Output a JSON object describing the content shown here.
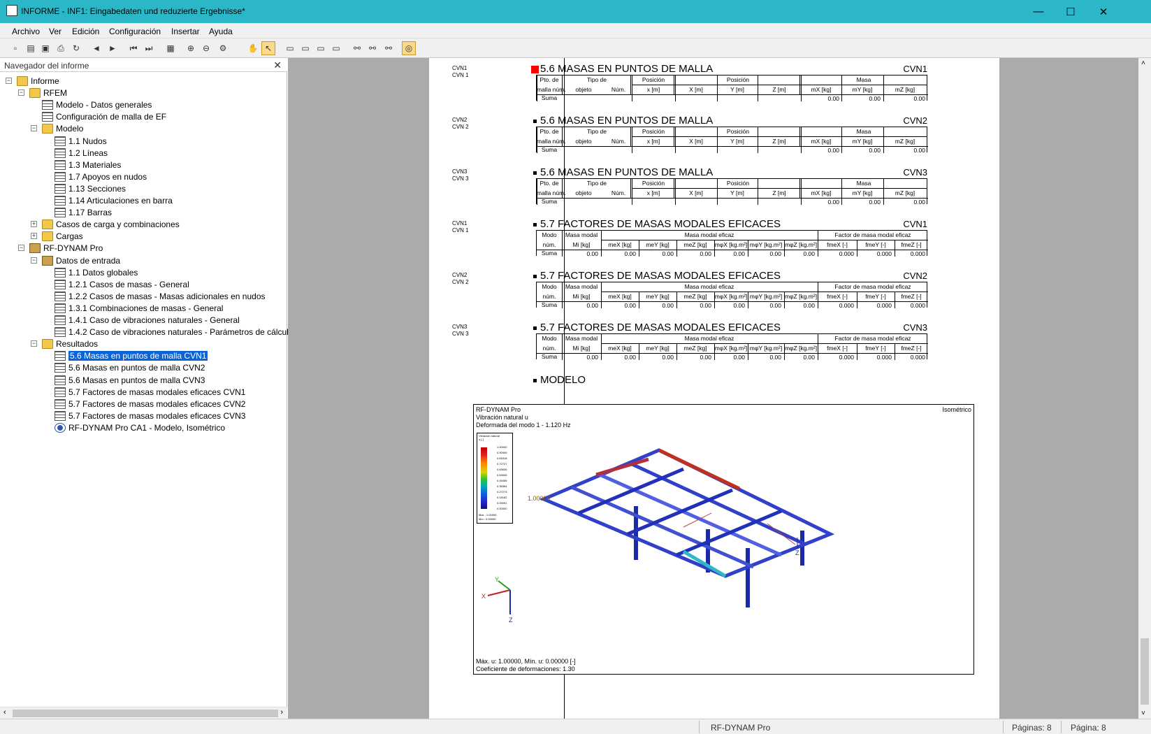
{
  "window": {
    "title": "INFORME - INF1: Eingabedaten und reduzierte Ergebnisse*",
    "minimize": "—",
    "maximize": "☐",
    "close": "✕"
  },
  "menu": [
    "Archivo",
    "Ver",
    "Edición",
    "Configuración",
    "Insertar",
    "Ayuda"
  ],
  "navigator": {
    "title": "Navegador del informe",
    "close": "✕",
    "items": [
      {
        "label": "Informe",
        "icon": "folder-icon"
      },
      {
        "label": "RFEM",
        "icon": "folder-icon"
      },
      {
        "label": "Modelo - Datos generales",
        "icon": "table-icon"
      },
      {
        "label": "Configuración de malla de EF",
        "icon": "table-icon"
      },
      {
        "label": "Modelo",
        "icon": "folder-icon"
      },
      {
        "label": "1.1 Nudos",
        "icon": "table-icon"
      },
      {
        "label": "1.2 Líneas",
        "icon": "table-icon"
      },
      {
        "label": "1.3 Materiales",
        "icon": "table-icon"
      },
      {
        "label": "1.7 Apoyos en nudos",
        "icon": "table-icon"
      },
      {
        "label": "1.13 Secciones",
        "icon": "table-icon"
      },
      {
        "label": "1.14 Articulaciones en barra",
        "icon": "table-icon"
      },
      {
        "label": "1.17 Barras",
        "icon": "table-icon"
      },
      {
        "label": "Casos de carga y combinaciones",
        "icon": "folder-icon"
      },
      {
        "label": "Cargas",
        "icon": "folder-icon"
      },
      {
        "label": "RF-DYNAM Pro",
        "icon": "dynam-icon"
      },
      {
        "label": "Datos de entrada",
        "icon": "dynam-icon"
      },
      {
        "label": "1.1 Datos globales",
        "icon": "table-icon"
      },
      {
        "label": "1.2.1 Casos de masas - General",
        "icon": "table-icon"
      },
      {
        "label": "1.2.2 Casos de masas - Masas adicionales en nudos",
        "icon": "table-icon"
      },
      {
        "label": "1.3.1 Combinaciones de masas - General",
        "icon": "table-icon"
      },
      {
        "label": "1.4.1 Caso de vibraciones naturales - General",
        "icon": "table-icon"
      },
      {
        "label": "1.4.2 Caso de vibraciones naturales - Parámetros de cálculo",
        "icon": "table-icon"
      },
      {
        "label": "Resultados",
        "icon": "folder-icon"
      },
      {
        "label": "5.6 Masas en puntos de malla CVN1",
        "icon": "table-icon",
        "selected": true
      },
      {
        "label": "5.6 Masas en puntos de malla CVN2",
        "icon": "table-icon"
      },
      {
        "label": "5.6 Masas en puntos de malla CVN3",
        "icon": "table-icon"
      },
      {
        "label": "5.7 Factores de masas modales eficaces CVN1",
        "icon": "table-icon"
      },
      {
        "label": "5.7 Factores de masas modales eficaces CVN2",
        "icon": "table-icon"
      },
      {
        "label": "5.7 Factores de masas modales eficaces CVN3",
        "icon": "table-icon"
      },
      {
        "label": "RF-DYNAM Pro CA1 - Modelo, Isométrico",
        "icon": "model-icon"
      }
    ]
  },
  "doc": {
    "masas_title": "5.6 MASAS EN PUNTOS DE MALLA",
    "factores_title": "5.7 FACTORES DE MASAS MODALES EFICACES",
    "modelo_title": "MODELO",
    "cvn": [
      "CVN1",
      "CVN2",
      "CVN3"
    ],
    "cvn_sub": [
      "CVN 1",
      "CVN 2",
      "CVN 3"
    ],
    "masas_header": {
      "pto1": "Pto. de",
      "pto2": "malla núm.",
      "tipo": "Tipo de",
      "objeto": "objeto",
      "num": "Núm.",
      "posicion": "Posición",
      "pos_x": "x [m]",
      "pos_group": "Posición",
      "X": "X [m]",
      "Y": "Y [m]",
      "Z": "Z [m]",
      "masa": "Masa",
      "mx": "mX [kg]",
      "my": "mY [kg]",
      "mz": "mZ [kg]",
      "suma": "Suma",
      "zero": "0.00"
    },
    "fact_header": {
      "modo1": "Modo",
      "modo2": "núm.",
      "masa_modal": "Masa modal",
      "mi": "Mi [kg]",
      "masa_eficaz": "Masa modal eficaz",
      "meX": "meX [kg]",
      "meY": "meY [kg]",
      "meZ": "meZ [kg]",
      "mpX": "mφX [kg.m²]",
      "mpY": "mφY [kg.m²]",
      "mpZ": "mφZ [kg.m²]",
      "factor": "Factor de masa modal eficaz",
      "fX": "fmeX [-]",
      "fY": "fmeY [-]",
      "fZ": "fmeZ [-]",
      "suma": "Suma",
      "zero": "0.00",
      "zero3": "0.000"
    },
    "figure": {
      "l1": "RF-DYNAM Pro",
      "l2": "Vibración natural u",
      "l3": "Deformada del modo 1 - 1.120 Hz",
      "view": "Isométrico",
      "max_label": "1.00000",
      "foot1": "Máx. u: 1.00000, Mín. u: 0.00000 [-]",
      "foot2": "Coeficiente de deformaciones: 1.30",
      "axis_x": "X",
      "axis_y": "Y",
      "axis_z": "Z",
      "legend_title": "Vibración natural",
      "legend_unit": "u [-]",
      "legend_values": [
        "1.00000",
        "0.90909",
        "0.81818",
        "0.72727",
        "0.63636",
        "0.54545",
        "0.45455",
        "0.36364",
        "0.27273",
        "0.18182",
        "0.09091",
        "0.00000"
      ],
      "legend_max": "Máx :",
      "legend_min": "Mín :",
      "legend_maxv": "1.00000",
      "legend_minv": "0.00000"
    }
  },
  "status": {
    "module": "RF-DYNAM Pro",
    "pages_label": "Páginas: 8",
    "page_label": "Página: 8"
  }
}
